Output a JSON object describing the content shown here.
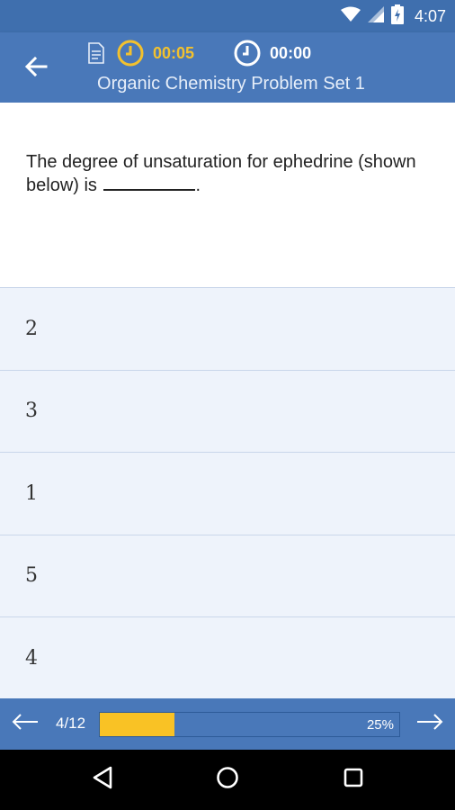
{
  "status_bar": {
    "time": "4:07",
    "icons": [
      "wifi-icon",
      "cellular-signal-icon",
      "battery-charging-icon"
    ]
  },
  "header": {
    "title": "Organic Chemistry Problem Set 1",
    "elapsed_timer": "00:05",
    "total_timer": "00:00",
    "icons": [
      "back-arrow-icon",
      "document-icon",
      "clock-icon"
    ],
    "colors": {
      "bar": "#4978b9",
      "accent": "#f2c12e"
    }
  },
  "question": {
    "text": "The degree of unsaturation for ephedrine (shown below) is",
    "suffix": "."
  },
  "answers": [
    {
      "label": "2"
    },
    {
      "label": "3"
    },
    {
      "label": "1"
    },
    {
      "label": "5"
    },
    {
      "label": "4"
    }
  ],
  "progress": {
    "count": "4/12",
    "percent_label": "25%",
    "fraction": 0.25,
    "colors": {
      "fill": "#f9c225"
    }
  },
  "nav_bar": {
    "icons": [
      "nav-back-icon",
      "nav-home-icon",
      "nav-recents-icon"
    ]
  }
}
